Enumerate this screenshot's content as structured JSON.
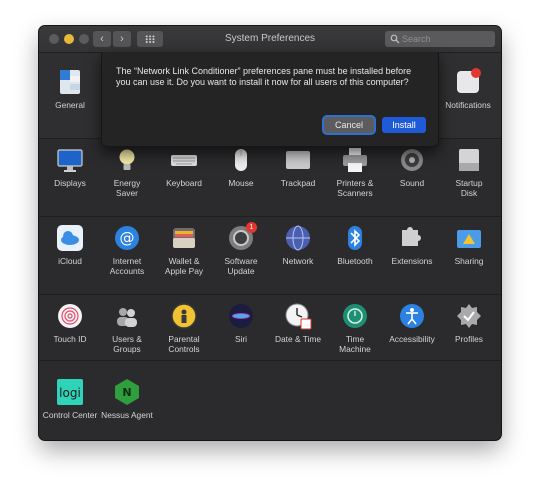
{
  "window": {
    "title": "System Preferences",
    "search_placeholder": "Search"
  },
  "dialog": {
    "message": "The “Network Link Conditioner” preferences pane must be installed before you can use it. Do you want to install it now for all users of this computer?",
    "cancel_label": "Cancel",
    "install_label": "Install"
  },
  "panes": {
    "general": "General",
    "notifications": "Notifications",
    "displays": "Displays",
    "energy_saver": "Energy\nSaver",
    "keyboard": "Keyboard",
    "mouse": "Mouse",
    "trackpad": "Trackpad",
    "printers": "Printers &\nScanners",
    "sound": "Sound",
    "startup_disk": "Startup\nDisk",
    "icloud": "iCloud",
    "internet_accounts": "Internet\nAccounts",
    "wallet": "Wallet &\nApple Pay",
    "software_update": "Software\nUpdate",
    "network": "Network",
    "bluetooth": "Bluetooth",
    "extensions": "Extensions",
    "sharing": "Sharing",
    "touch_id": "Touch ID",
    "users_groups": "Users &\nGroups",
    "parental_controls": "Parental\nControls",
    "siri": "Siri",
    "date_time": "Date & Time",
    "time_machine": "Time\nMachine",
    "accessibility": "Accessibility",
    "profiles": "Profiles",
    "control_center": "Control Center",
    "nessus_agent": "Nessus Agent"
  },
  "badges": {
    "software_update_count": "1"
  },
  "colors": {
    "accent": "#1f5bd8",
    "window_bg": "#2b2b2d"
  }
}
